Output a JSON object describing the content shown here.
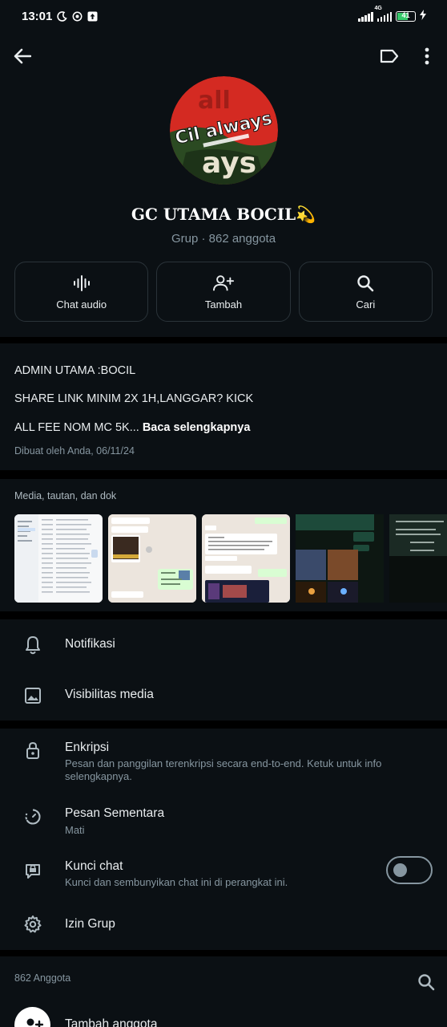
{
  "status_bar": {
    "time": "13:01",
    "network": "4G",
    "battery": "41",
    "icons": [
      "moon-icon",
      "whatsapp-icon",
      "upload-icon",
      "signal-icon",
      "battery-icon",
      "charging-icon"
    ]
  },
  "header": {
    "icons": [
      "back-arrow-icon",
      "label-icon",
      "more-vert-icon"
    ]
  },
  "group": {
    "avatar_text": "Cil always",
    "name": "GC UTAMA BOCIL💫",
    "subtitle": "Grup · 862 anggota"
  },
  "actions": [
    {
      "label": "Chat audio",
      "icon": "audio-wave-icon"
    },
    {
      "label": "Tambah",
      "icon": "add-person-icon"
    },
    {
      "label": "Cari",
      "icon": "search-icon"
    }
  ],
  "description": {
    "line1": "ADMIN UTAMA :BOCIL",
    "line2": "SHARE LINK MINIM 2X 1H,LANGGAR? KICK",
    "line3": "ALL FEE NOM MC 5K... ",
    "read_more": "Baca selengkapnya",
    "created": "Dibuat oleh Anda, 06/11/24"
  },
  "media": {
    "title": "Media, tautan, dan dok"
  },
  "settings": {
    "notifications": "Notifikasi",
    "media_visibility": "Visibilitas media",
    "encryption_title": "Enkripsi",
    "encryption_sub": "Pesan dan panggilan terenkripsi secara end-to-end. Ketuk untuk info selengkapnya.",
    "disappearing_title": "Pesan Sementara",
    "disappearing_sub": "Mati",
    "chat_lock_title": "Kunci chat",
    "chat_lock_sub": "Kunci dan sembunyikan chat ini di perangkat ini.",
    "chat_lock_on": false,
    "group_permissions": "Izin Grup"
  },
  "members": {
    "count_label": "862 Anggota",
    "add_member": "Tambah anggota"
  },
  "colors": {
    "background": "#0b1014",
    "text_primary": "#e9edef",
    "text_secondary": "#8696a0",
    "separator": "#000000"
  }
}
